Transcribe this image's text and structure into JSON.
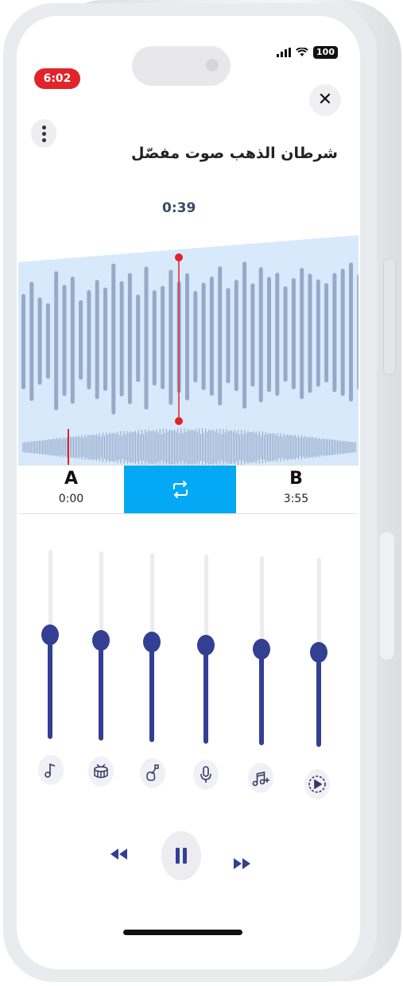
{
  "status": {
    "battery": "100"
  },
  "record_badge": "6:02",
  "track": {
    "title": "شرطان الذهب صوت مفصّل",
    "current_time": "0:39"
  },
  "loop": {
    "a_label": "A",
    "a_time": "0:00",
    "b_label": "B",
    "b_time": "3:55"
  },
  "mixer": {
    "sliders": [
      {
        "stem": "music-note",
        "level": 0.55
      },
      {
        "stem": "drum",
        "level": 0.53
      },
      {
        "stem": "guitar",
        "level": 0.53
      },
      {
        "stem": "microphone",
        "level": 0.52
      },
      {
        "stem": "music-notes-plus",
        "level": 0.51
      },
      {
        "stem": "play-circle",
        "level": 0.5
      }
    ]
  },
  "colors": {
    "accent": "#03a9f4",
    "slider": "#323f92",
    "playhead": "#e0242a",
    "wave": "#97a9c8",
    "wave_bg": "#d7e9fb"
  }
}
